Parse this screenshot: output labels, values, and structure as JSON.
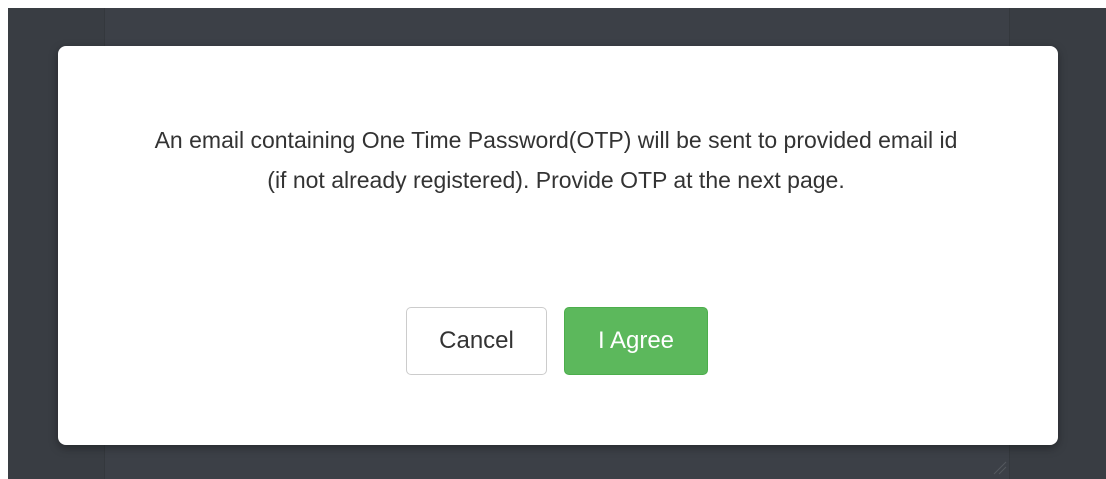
{
  "dialog": {
    "message": "An email containing One Time Password(OTP) will be sent to provided email id (if not already registered). Provide OTP at the next page.",
    "cancel_label": "Cancel",
    "agree_label": "I Agree"
  },
  "colors": {
    "backdrop": "#393d43",
    "modal_background": "#ffffff",
    "agree_button": "#5cb85c",
    "message_text": "#333333"
  }
}
